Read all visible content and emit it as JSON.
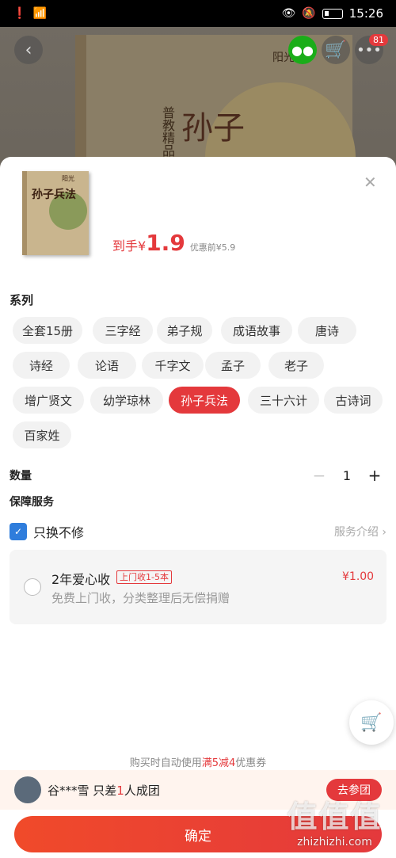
{
  "status_bar": {
    "time": "15:26",
    "signal": "4G"
  },
  "top_nav": {
    "cart_badge": "81"
  },
  "product": {
    "price_label": "到手",
    "currency": "¥",
    "price": "1.9",
    "original_price": "优惠前¥5.9",
    "cover_title": "孙子兵法",
    "bg_cover_title": "孙子",
    "bg_cover_series": "普教精品",
    "bg_brand": "阳光"
  },
  "series": {
    "title": "系列",
    "options": [
      "全套15册",
      "三字经",
      "弟子规",
      "成语故事",
      "唐诗",
      "诗经",
      "论语",
      "千字文",
      "孟子",
      "老子",
      "增广贤文",
      "幼学琼林",
      "孙子兵法",
      "三十六计",
      "古诗词",
      "百家姓"
    ],
    "selected": "孙子兵法"
  },
  "quantity": {
    "label": "数量",
    "value": "1"
  },
  "guarantee": {
    "title": "保障服务",
    "name": "只换不修",
    "link": "服务介绍"
  },
  "service_card": {
    "title": "2年爱心收",
    "tag": "上门收1-5本",
    "desc": "免费上门收，分类整理后无偿捐赠",
    "price": "¥1.00"
  },
  "coupon_tip": {
    "prefix": "购买时自动使用",
    "highlight": "满5减4",
    "suffix": "优惠券"
  },
  "group_buy": {
    "user": "谷***雪 只差",
    "count": "1",
    "suffix": "人成团",
    "button": "去参团"
  },
  "confirm_label": "确定",
  "watermark": {
    "logo": "值",
    "url": "zhizhizhi.com"
  },
  "colors": {
    "accent": "#e4393c",
    "blue": "#2f7ddc"
  }
}
